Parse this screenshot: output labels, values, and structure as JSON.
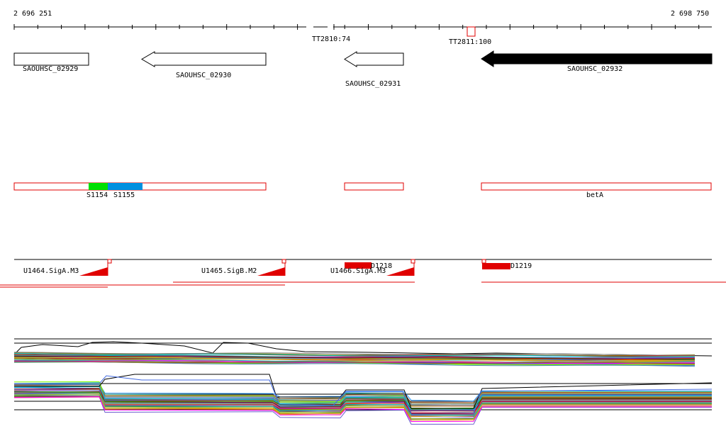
{
  "coords": {
    "start": "2 696 251",
    "end": "2 698 750"
  },
  "terminators": [
    {
      "id": "t1",
      "label": "TT2810:74"
    },
    {
      "id": "t2",
      "label": "TT2811:100"
    }
  ],
  "genes": [
    {
      "id": "g1",
      "label": "SAOUHSC_02929"
    },
    {
      "id": "g2",
      "label": "SAOUHSC_02930"
    },
    {
      "id": "g3",
      "label": "SAOUHSC_02931"
    },
    {
      "id": "g4",
      "label": "SAOUHSC_02932"
    }
  ],
  "segments": [
    {
      "id": "s1",
      "label": "S1154"
    },
    {
      "id": "s2",
      "label": "S1155"
    },
    {
      "id": "s3",
      "label": "betA"
    }
  ],
  "tus": [
    {
      "id": "u1",
      "label": "U1464.SigA.M3"
    },
    {
      "id": "u2",
      "label": "U1465.SigB.M2"
    },
    {
      "id": "u3",
      "label": "U1466.SigA.M3"
    }
  ],
  "down": [
    {
      "id": "d1",
      "label": "D1218"
    },
    {
      "id": "d2",
      "label": "D1219"
    }
  ],
  "colors": {
    "outline": "#e00000",
    "s1154": "#00e000",
    "s1155": "#0090e0",
    "gene_filled": "#000000"
  }
}
